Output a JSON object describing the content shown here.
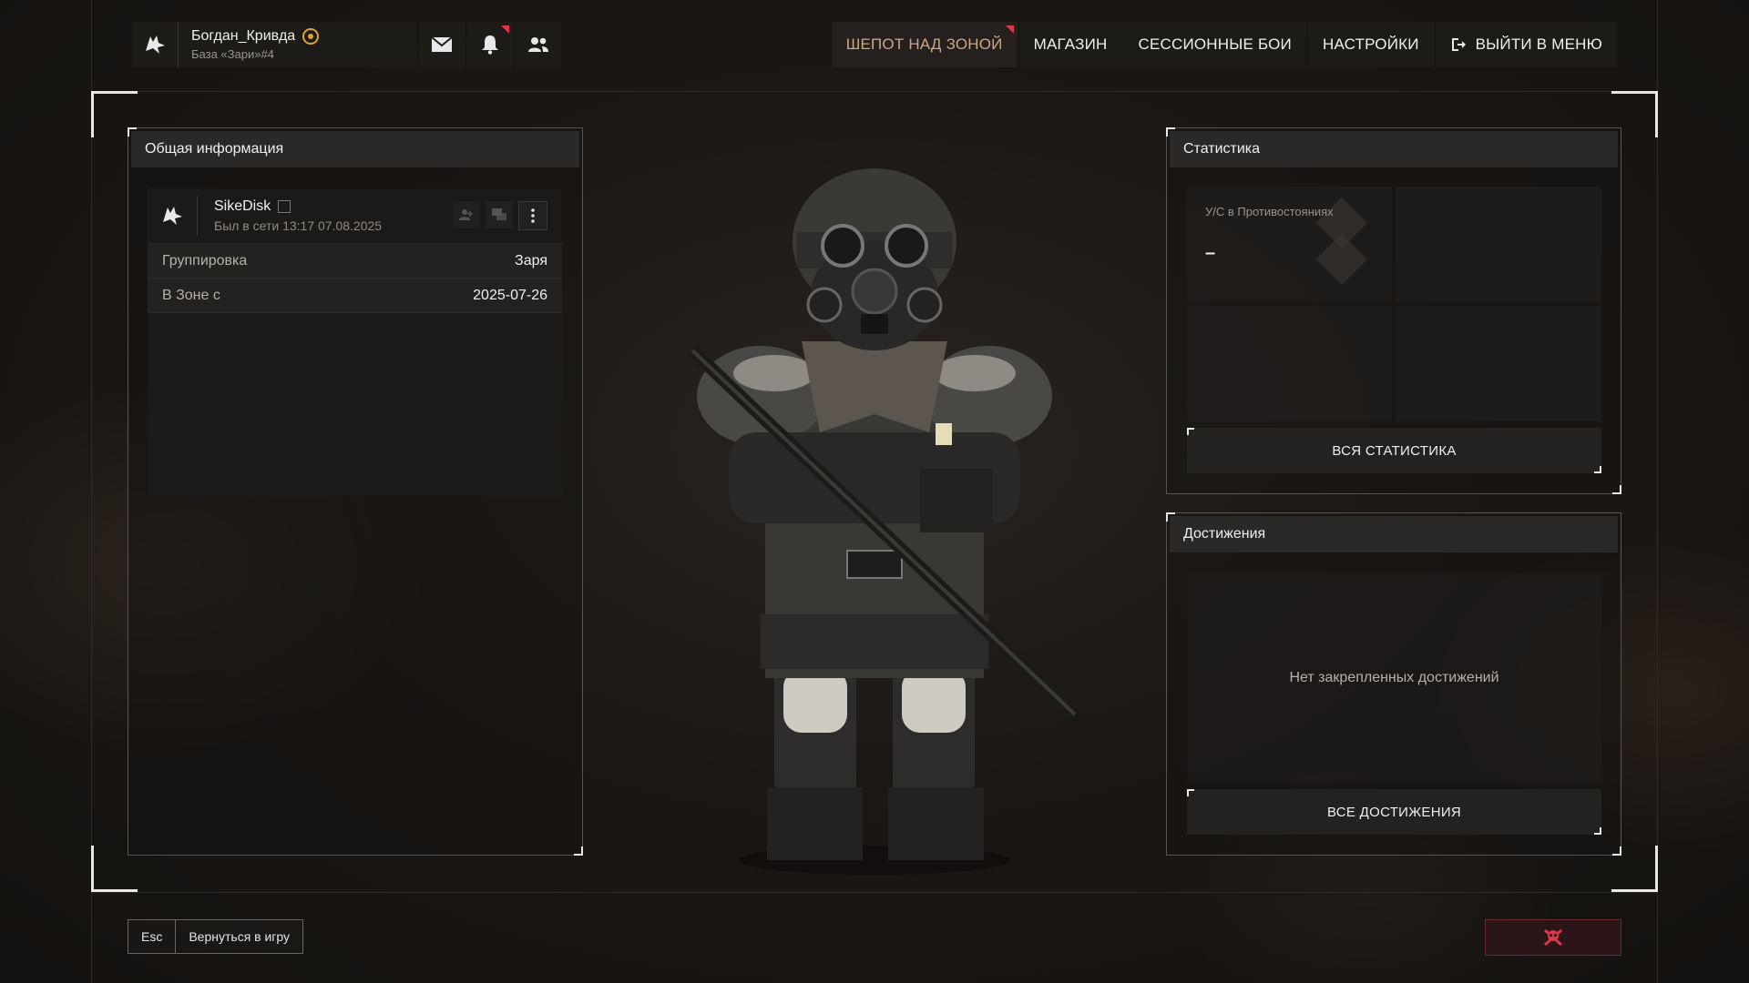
{
  "header": {
    "user": {
      "name": "Богдан_Кривда",
      "base": "База «Зари»#4"
    },
    "icons": {
      "mail": "mail-icon",
      "notifications": "bell-icon",
      "friends": "friends-icon"
    },
    "nav": [
      {
        "label": "ШЕПОТ НАД ЗОНОЙ",
        "active": true
      },
      {
        "label": "МАГАЗИН"
      },
      {
        "label": "СЕССИОННЫЕ БОИ"
      },
      {
        "label": "НАСТРОЙКИ"
      },
      {
        "label": "ВЫЙТИ В МЕНЮ",
        "icon": "logout-icon"
      }
    ]
  },
  "general": {
    "title": "Общая информация",
    "player": {
      "name": "SikeDisk",
      "last_seen": "Был в сети 13:17 07.08.2025"
    },
    "rows": [
      {
        "label": "Группировка",
        "value": "Заря"
      },
      {
        "label": "В Зоне с",
        "value": "2025-07-26"
      }
    ]
  },
  "stats": {
    "title": "Статистика",
    "kd_label": "У/С в Противостояниях",
    "kd_value": "–",
    "all_button": "ВСЯ СТАТИСТИКА"
  },
  "achievements": {
    "title": "Достижения",
    "empty": "Нет закрепленных достижений",
    "all_button": "ВСЕ ДОСТИЖЕНИЯ"
  },
  "footer": {
    "esc_key": "Esc",
    "esc_label": "Вернуться в игру",
    "danger_icon": "skull-crossbones-icon"
  },
  "colors": {
    "accent": "#c8a986",
    "notify": "#e0344a",
    "badge": "#d7a53a",
    "danger": "#e0344a"
  }
}
